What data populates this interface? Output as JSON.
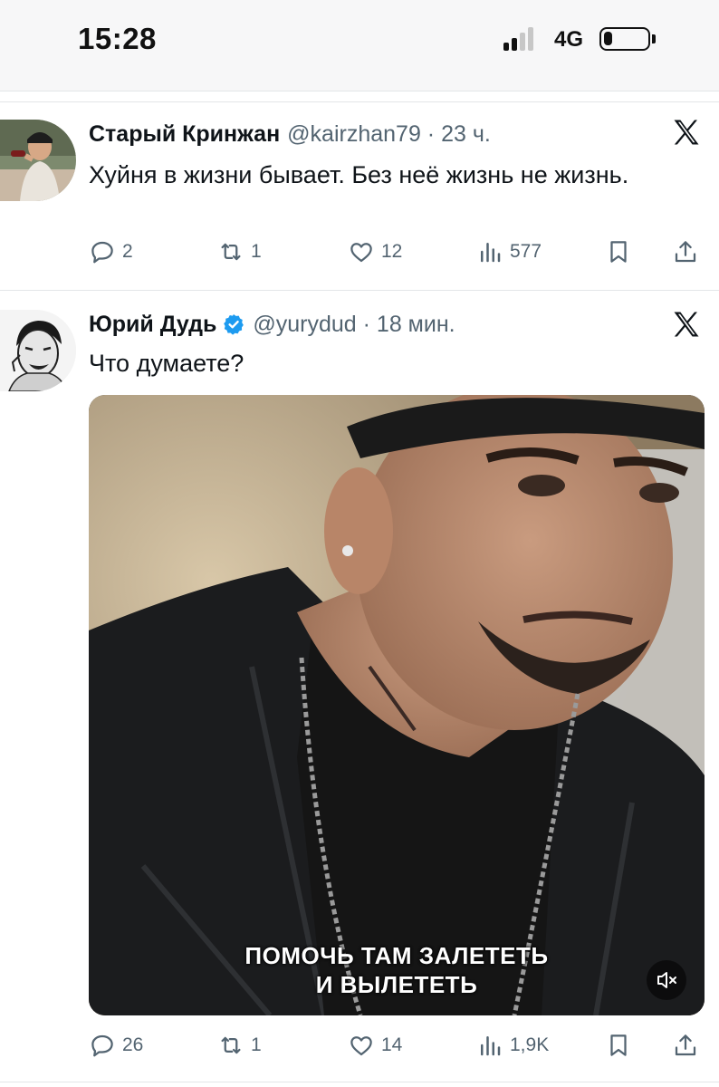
{
  "status_bar": {
    "time": "15:28",
    "network": "4G",
    "battery_level": 0.2,
    "signal_bars_active": 2
  },
  "colors": {
    "text_primary": "#0f1419",
    "text_secondary": "#536471",
    "verified_blue": "#1d9bf0"
  },
  "tweets": [
    {
      "author_name": "Старый Кринжан",
      "handle_time": "@kairzhan79 · 23 ч.",
      "text": "Хуйня в жизни бывает. Без неё жизнь не жизнь.",
      "verified": false,
      "actions": {
        "replies": "2",
        "retweets": "1",
        "likes": "12",
        "views": "577"
      }
    },
    {
      "author_name": "Юрий Дудь",
      "handle_time": "@yurydud · 18 мин.",
      "text": "Что думаете?",
      "verified": true,
      "media": {
        "type": "video",
        "caption_line1": "ПОМОЧЬ ТАМ ЗАЛЕТЕТЬ",
        "caption_line2": "И ВЫЛЕТЕТЬ",
        "muted": true
      },
      "actions": {
        "replies": "26",
        "retweets": "1",
        "likes": "14",
        "views": "1,9K"
      }
    }
  ],
  "icons": {
    "reply": "reply-icon",
    "retweet": "retweet-icon",
    "like": "like-icon",
    "views": "views-icon",
    "bookmark": "bookmark-icon",
    "share": "share-icon",
    "platform": "x-logo-icon",
    "mute": "mute-icon"
  }
}
